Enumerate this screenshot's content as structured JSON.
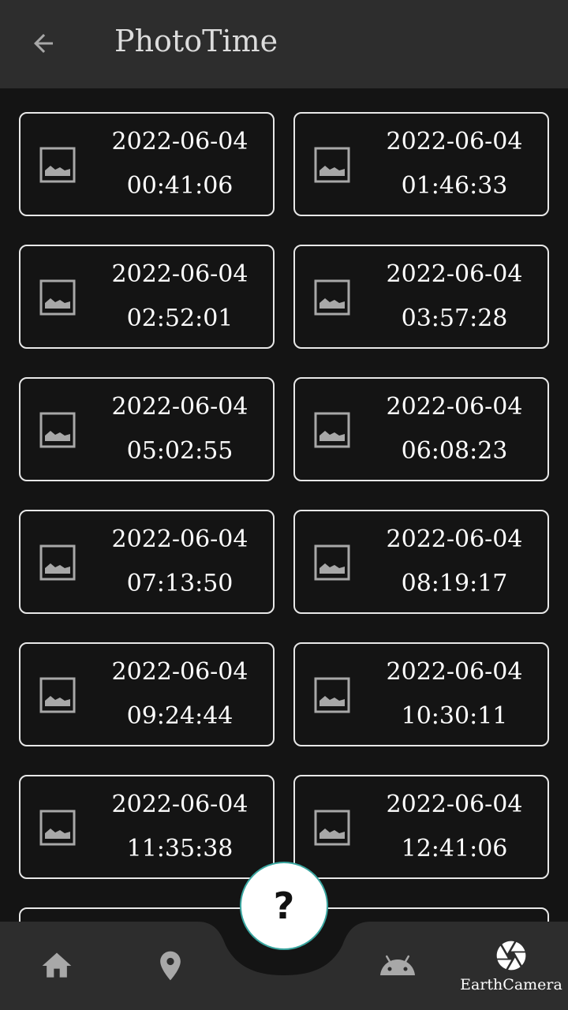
{
  "appbar": {
    "title": "PhotoTime"
  },
  "photos": [
    {
      "date": "2022-06-04",
      "time": "00:41:06"
    },
    {
      "date": "2022-06-04",
      "time": "01:46:33"
    },
    {
      "date": "2022-06-04",
      "time": "02:52:01"
    },
    {
      "date": "2022-06-04",
      "time": "03:57:28"
    },
    {
      "date": "2022-06-04",
      "time": "05:02:55"
    },
    {
      "date": "2022-06-04",
      "time": "06:08:23"
    },
    {
      "date": "2022-06-04",
      "time": "07:13:50"
    },
    {
      "date": "2022-06-04",
      "time": "08:19:17"
    },
    {
      "date": "2022-06-04",
      "time": "09:24:44"
    },
    {
      "date": "2022-06-04",
      "time": "10:30:11"
    },
    {
      "date": "2022-06-04",
      "time": "11:35:38"
    },
    {
      "date": "2022-06-04",
      "time": "12:41:06"
    }
  ],
  "fab": {
    "label": "?"
  },
  "bottom_nav": {
    "items": [
      {
        "icon": "home-icon",
        "label": ""
      },
      {
        "icon": "location-pin-icon",
        "label": ""
      },
      {
        "icon": "android-icon",
        "label": ""
      },
      {
        "icon": "camera-aperture-icon",
        "label": "EarthCamera"
      }
    ]
  },
  "colors": {
    "appbar_bg": "#2d2d2d",
    "page_bg": "#141414",
    "nav_bg": "#2d2d2d",
    "fab_border": "#3aa6a0"
  }
}
